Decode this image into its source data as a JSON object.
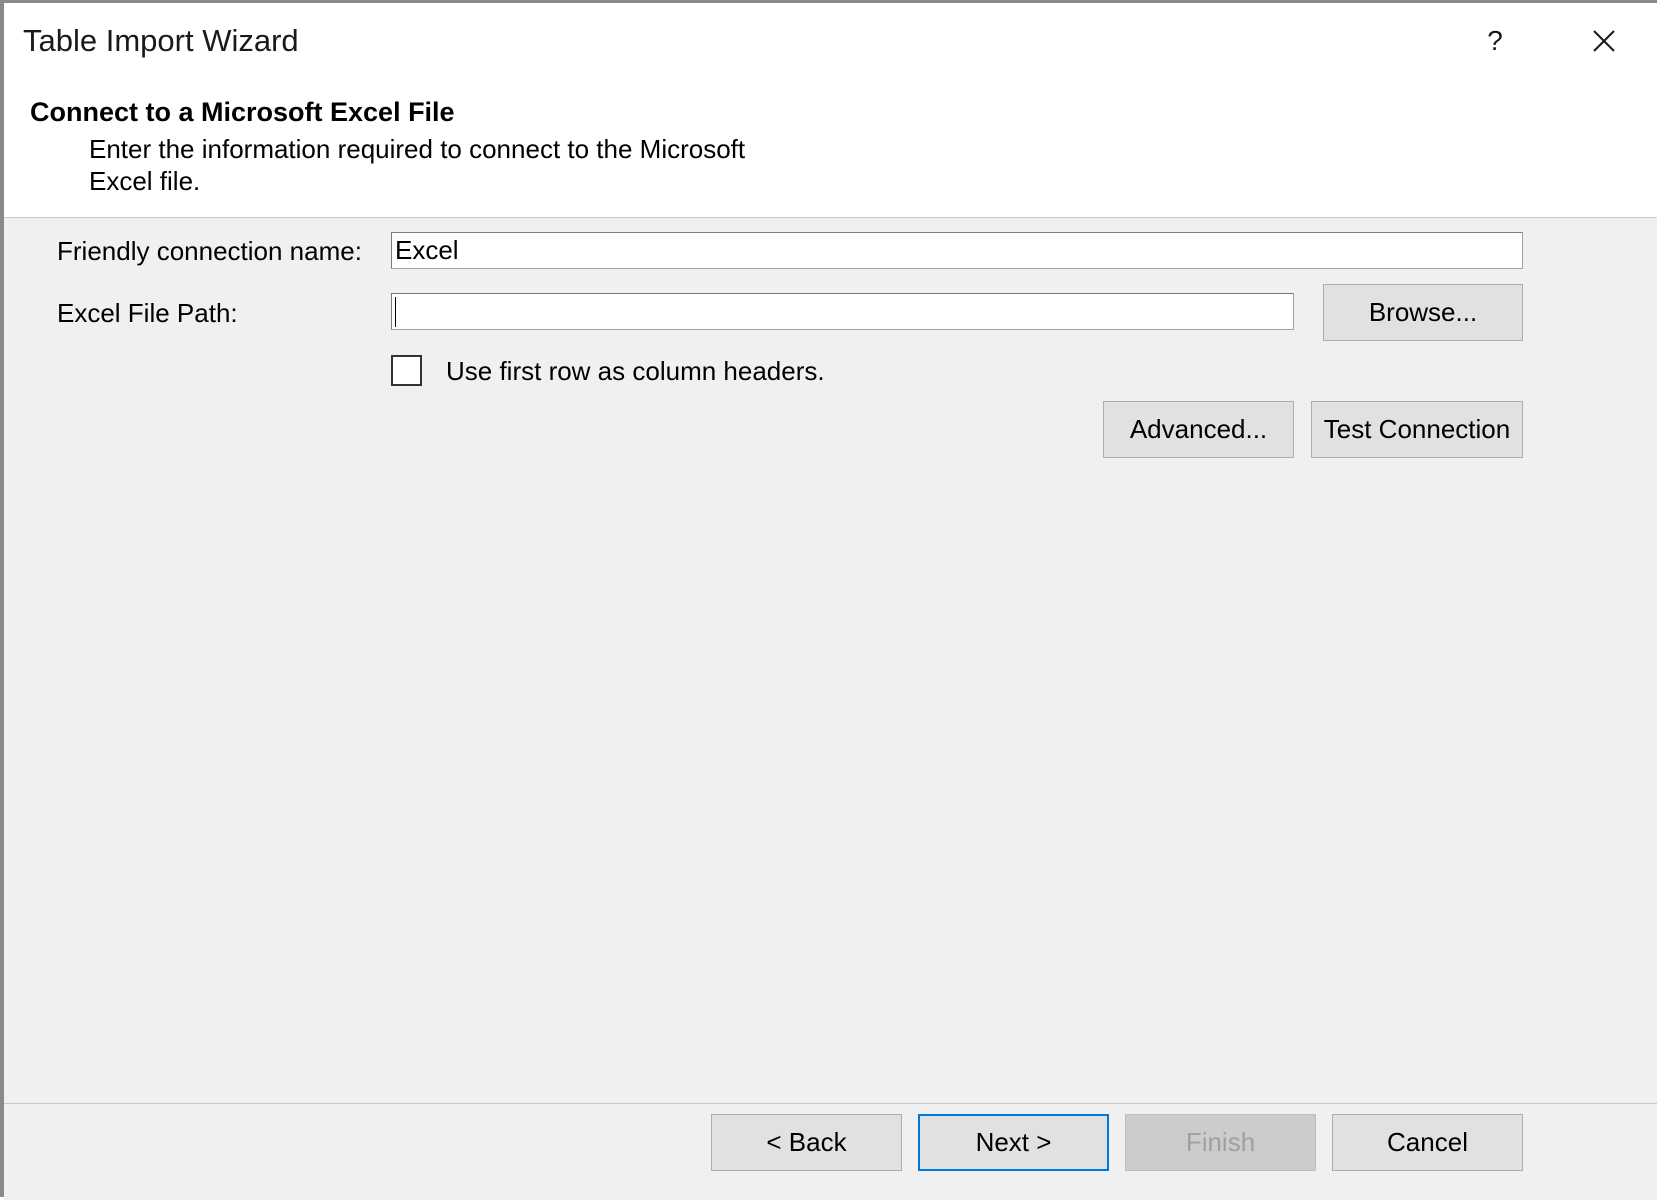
{
  "window": {
    "title": "Table Import Wizard",
    "help_label": "?",
    "close_icon": "close-icon"
  },
  "header": {
    "title": "Connect to a Microsoft Excel File",
    "description": "Enter the information required to connect to the Microsoft Excel file."
  },
  "form": {
    "friendly_name_label": "Friendly connection name:",
    "friendly_name_value": "Excel",
    "file_path_label": "Excel File Path:",
    "file_path_value": "",
    "browse_label": "Browse...",
    "first_row_label": "Use first row as column headers.",
    "first_row_checked": false,
    "advanced_label": "Advanced...",
    "test_connection_label": "Test Connection"
  },
  "footer": {
    "back_label": "< Back",
    "next_label": "Next >",
    "finish_label": "Finish",
    "cancel_label": "Cancel"
  },
  "colors": {
    "accent": "#0078d7",
    "panel": "#f0f0f0",
    "button": "#e1e1e1"
  }
}
